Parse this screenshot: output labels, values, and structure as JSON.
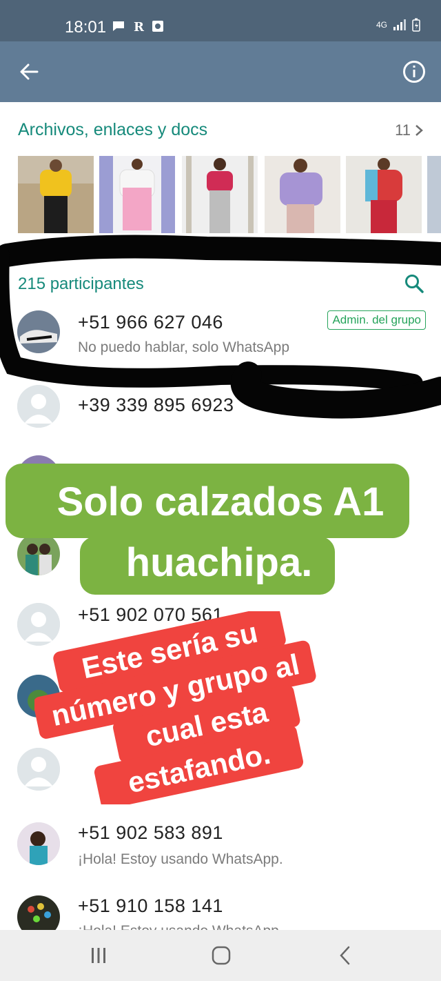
{
  "status": {
    "time": "18:01",
    "network": "4G"
  },
  "header": {
    "back_icon": "arrow-left-icon",
    "info_icon": "info-circle-icon"
  },
  "media": {
    "title": "Archivos, enlaces y docs",
    "count": "11"
  },
  "participants": {
    "title": "215 participantes",
    "admin_badge": "Admin. del grupo",
    "rows": [
      {
        "phone": "+51 966 627 046",
        "about": "No puedo hablar, solo WhatsApp"
      },
      {
        "phone": "+39 339 895 6923",
        "about": ""
      },
      {
        "phone": "+51 902 070 561",
        "about": ""
      },
      {
        "phone": "+51 902 583 891",
        "about": "¡Hola! Estoy usando WhatsApp."
      },
      {
        "phone": "+51 910 158 141",
        "about": "¡Hola! Estoy usando WhatsApp."
      }
    ]
  },
  "overlays": {
    "green_line1": "Solo calzados A1",
    "green_line2": "huachipa.",
    "red_line1": "Este sería su",
    "red_line2": "número y grupo al",
    "red_line3": "cual esta",
    "red_line4": "estafando."
  },
  "colors": {
    "status_bar": "#4f6478",
    "app_bar": "#617c96",
    "accent_teal": "#168a7b",
    "overlay_green": "#7cb342",
    "overlay_red": "#f0443f"
  }
}
